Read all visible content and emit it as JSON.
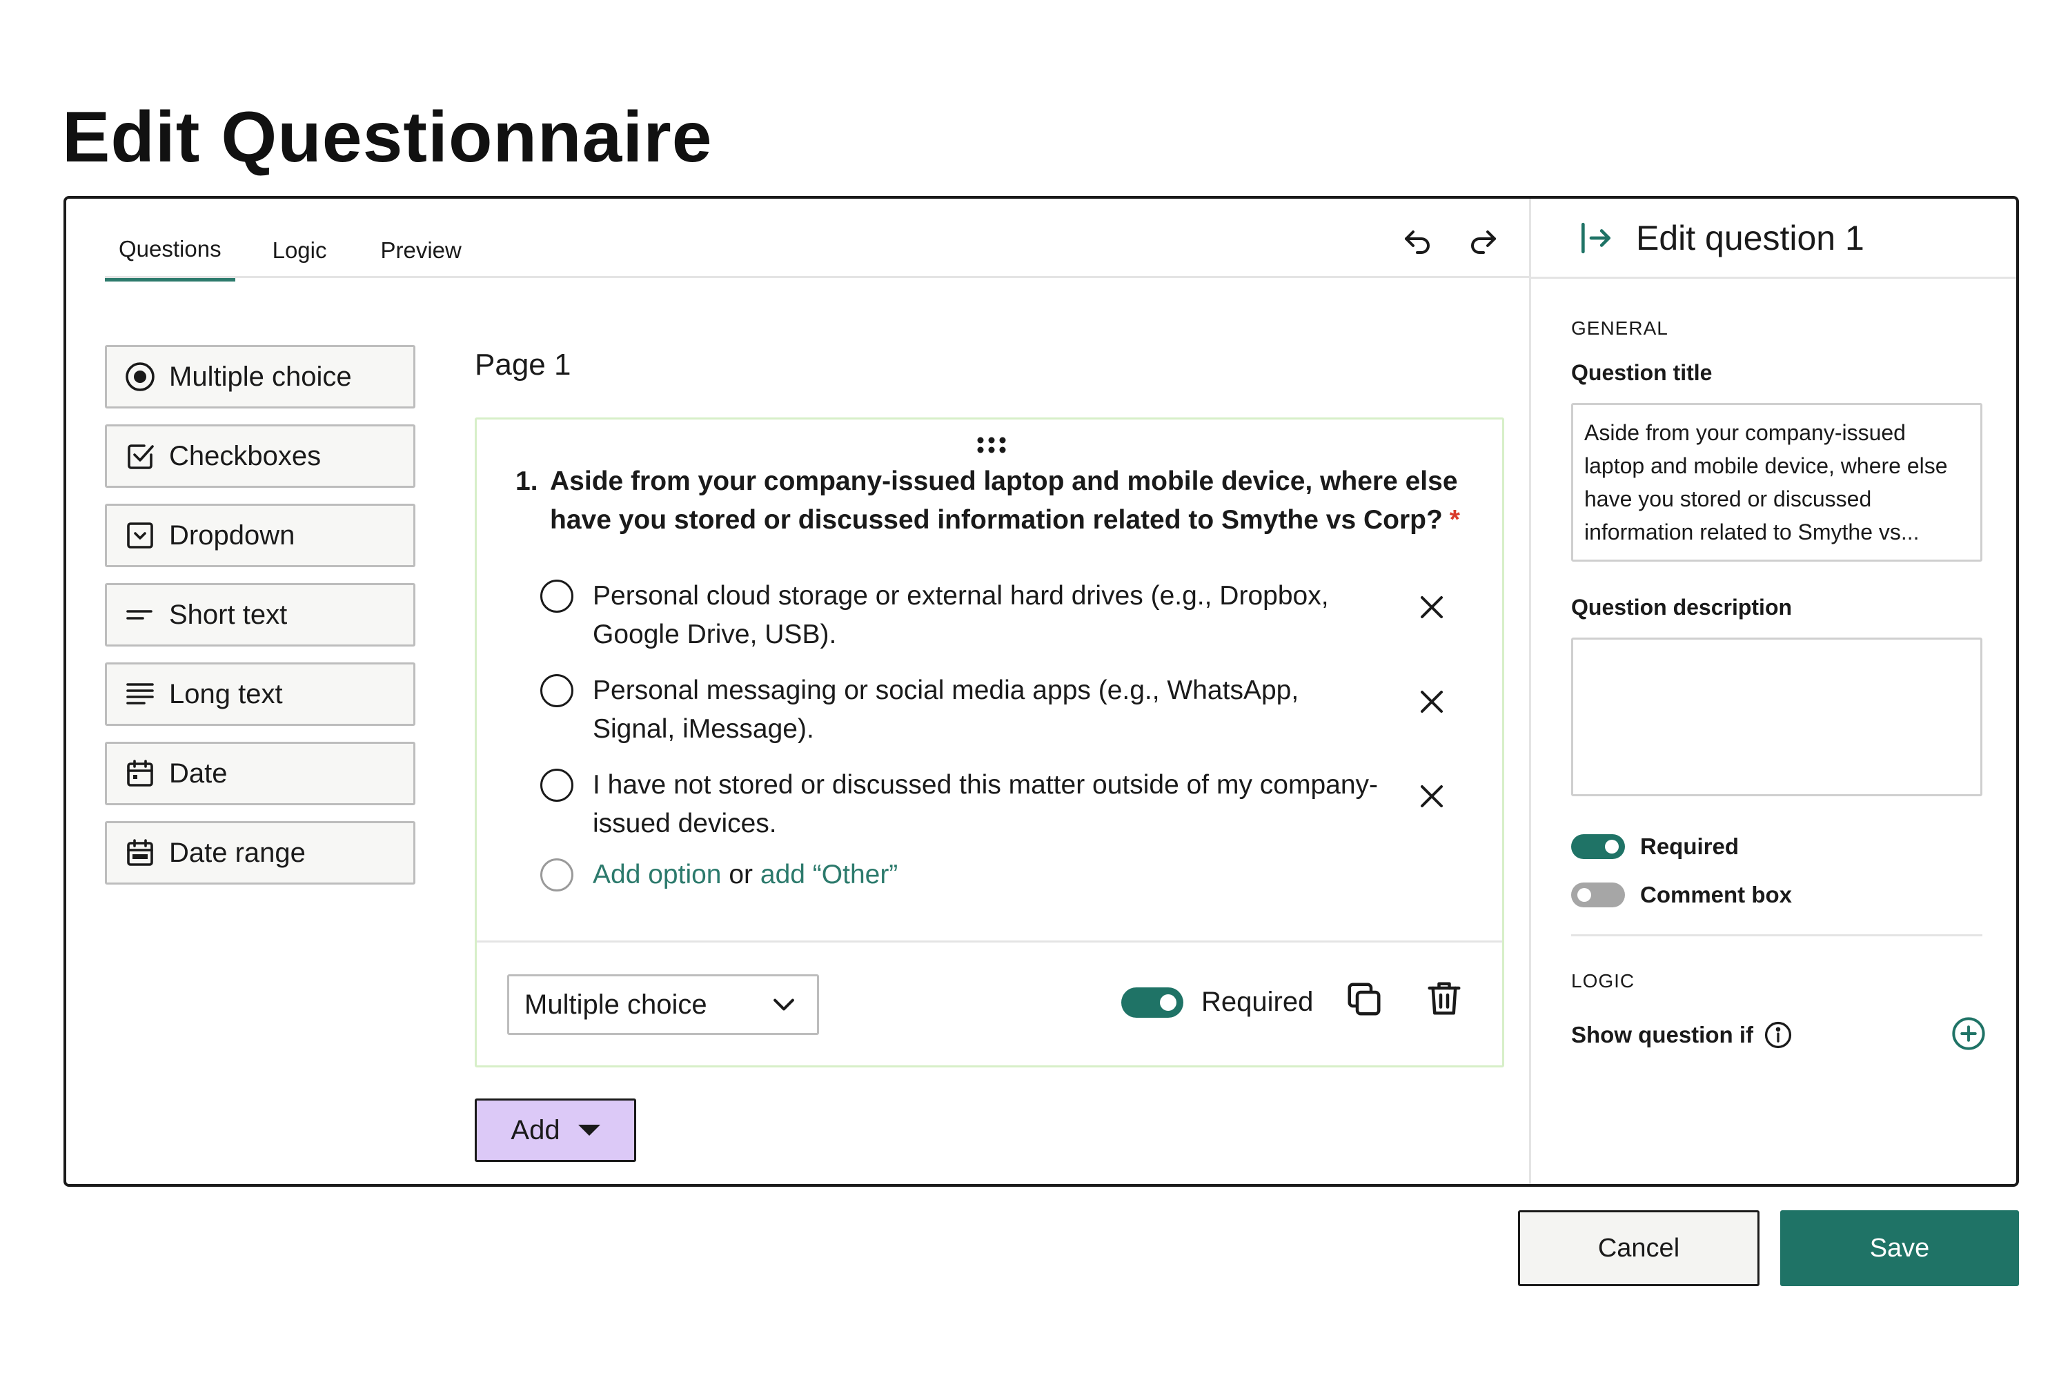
{
  "page": {
    "title": "Edit Questionnaire"
  },
  "tabs": [
    {
      "label": "Questions",
      "active": true
    },
    {
      "label": "Logic",
      "active": false
    },
    {
      "label": "Preview",
      "active": false
    }
  ],
  "toolbar": {
    "undo_icon": "undo-icon",
    "redo_icon": "redo-icon"
  },
  "palette": [
    {
      "label": "Multiple choice",
      "icon": "radio-icon"
    },
    {
      "label": "Checkboxes",
      "icon": "checkbox-icon"
    },
    {
      "label": "Dropdown",
      "icon": "dropdown-icon"
    },
    {
      "label": "Short text",
      "icon": "short-text-icon"
    },
    {
      "label": "Long text",
      "icon": "long-text-icon"
    },
    {
      "label": "Date",
      "icon": "calendar-icon"
    },
    {
      "label": "Date range",
      "icon": "calendar-range-icon"
    }
  ],
  "canvas": {
    "page_label": "Page 1",
    "question": {
      "number": "1.",
      "title": "Aside from your company-issued laptop and mobile device, where else have you stored or discussed information related to Smythe vs Corp?",
      "required_marker": "*",
      "options": [
        {
          "text": "Personal cloud storage or external hard drives (e.g., Dropbox, Google Drive, USB)."
        },
        {
          "text": "Personal messaging or social media apps (e.g., WhatsApp, Signal, iMessage)."
        },
        {
          "text": "I have not stored or discussed this matter outside of my company-issued devices."
        }
      ],
      "add_option_label": "Add option",
      "or_label": "or",
      "add_other_label": "add “Other”",
      "type_select_value": "Multiple choice",
      "required_label": "Required",
      "required_on": true
    },
    "add_button_label": "Add"
  },
  "side_panel": {
    "title": "Edit question 1",
    "general_label": "GENERAL",
    "question_title_label": "Question title",
    "question_title_value": "Aside from your company-issued laptop and mobile device, where else have you stored or discussed information related to Smythe vs...",
    "question_description_label": "Question description",
    "question_description_value": "",
    "required_label": "Required",
    "required_on": true,
    "comment_box_label": "Comment box",
    "comment_box_on": false,
    "logic_label": "LOGIC",
    "show_if_label": "Show question if"
  },
  "footer": {
    "cancel_label": "Cancel",
    "save_label": "Save"
  },
  "colors": {
    "accent": "#1f7366",
    "add_button": "#dcc9f7",
    "required_star": "#d93a2b",
    "card_border": "#d7efc8"
  }
}
